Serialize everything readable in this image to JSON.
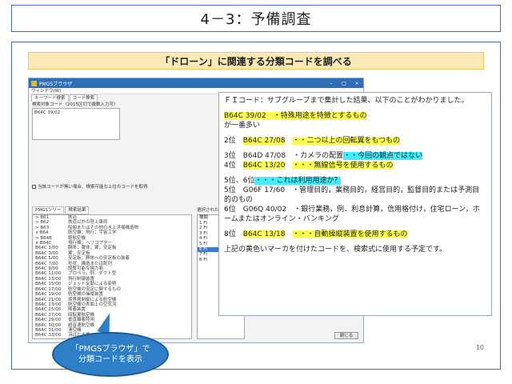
{
  "slide": {
    "title": "4－3：予備調査",
    "banner": "「ドローン」に関連する分類コードを調べる",
    "page_number": "10"
  },
  "app": {
    "title": "PMGSブラウザ",
    "menu": "ウィンドウ(W)",
    "tabs": [
      "キーワード検索",
      "コード検索"
    ],
    "input_label": "検索対象コード（2015区切で複数入力可）",
    "input_value": "B64C 39/02",
    "checkbox_label": "当該コードが無い場合、検索可能な上位のコードを取得",
    "tree_tabs": [
      "PMGSツリー",
      "検索結果"
    ],
    "tree": [
      {
        "code": "> B61",
        "desc": "鉄道"
      },
      {
        "code": "> B62",
        "desc": "鉄道以外の陸上車両"
      },
      {
        "code": "> B63",
        "desc": "船舶またはその他の水上浮揚構造物"
      },
      {
        "code": "∨ B64",
        "desc": "航空機；飛行；宇宙工学"
      },
      {
        "code": "  > B64B",
        "desc": "軽航空機"
      },
      {
        "code": "  ∨ B64C",
        "desc": "飛行機；ヘリコプター"
      },
      {
        "code": "    B64C 1/00",
        "desc": "胴体；翼体；翼；安定板"
      },
      {
        "code": "    B64C 3/00",
        "desc": "翼；安定板"
      },
      {
        "code": "    B64C 5/00",
        "desc": "安定板；胴体への安定板の装着"
      },
      {
        "code": "    B64C 7/00",
        "desc": "形状，構造または配列"
      },
      {
        "code": "    B64C 9/00",
        "desc": "調整可能な揚力面"
      },
      {
        "code": "    B64C 11/00",
        "desc": "プロペラ，例．ダクト型"
      },
      {
        "code": "    B64C 13/00",
        "desc": "飛行制御装置"
      },
      {
        "code": "    B64C 15/00",
        "desc": "ジェット反動による姿勢"
      },
      {
        "code": "    B64C 17/00",
        "desc": "航空機の安定に関するもの"
      },
      {
        "code": "    B64C 19/00",
        "desc": "航空機の操縦装置"
      },
      {
        "code": "    B64C 21/00",
        "desc": "境界層制御による航空機"
      },
      {
        "code": "    B64C 23/00",
        "desc": "航空機の表面上の空気流"
      },
      {
        "code": "    B64C 25/00",
        "desc": "降着装置"
      },
      {
        "code": "    B64C 27/00",
        "desc": "回転翼航空機"
      },
      {
        "code": "    B64C 29/00",
        "desc": "垂直離着陸用"
      },
      {
        "code": "    B64C 30/00",
        "desc": "超音速航空機"
      },
      {
        "code": "    B64C 31/00",
        "desc": "滑空機"
      },
      {
        "code": "    B64C 33/00",
        "desc": "羽ばたき機"
      },
      {
        "code": "    B64C 35/00",
        "desc": "陸上と水上の両用"
      },
      {
        "code": "    B64C 37/00",
        "desc": "複数の航空機の結合"
      },
      {
        "code": "    B64C 39/00",
        "desc": "特殊用途の航空機"
      },
      {
        "code": "  > B64D",
        "desc": "航空機の装備"
      }
    ],
    "right_list_header": "選択されたコード",
    "right_list": [
      "種類",
      "1 FI",
      "2 FI",
      "3 FI",
      "4 FI",
      "5 FI",
      "6 FI",
      "7 FI",
      "8 FI"
    ],
    "close_label": "閉じる"
  },
  "note": {
    "intro": "ＦＩコード：サブグループまで集計した結果、以下のことがわかりました。",
    "top_code": "B64C 39/02",
    "top_desc": "・特殊用途を特徴とするもの",
    "top_tail": "が一番多い",
    "r2_rank": "2位",
    "r2_code": "B64C 27/08",
    "r2_desc": "・・二つ以上の回転翼をもつもの",
    "r3_rank": "3位",
    "r3_code": "B64D 47/08",
    "r3_desc": "・カメラの配置",
    "r3_comment": "・・今回の観点ではない",
    "r4_rank": "4位",
    "r4_code": "B64C 13/20",
    "r4_desc": "・・・無線信号を使用するもの",
    "r56_rank": "5位、6位",
    "r56_comment": "・・・これは利用用途か？",
    "r5_rank": "5位",
    "r5_code": "G06F 17/60",
    "r5_desc": "・管理目的，業務目的，経営目的，監督目的または予測目的のもの",
    "r6_rank": "6位",
    "r6_code": "G06Q 40/02",
    "r6_desc": "・銀行業務，例．利息計算，信用格付け，住宅ローン，ホームまたはオンライン・バンキング",
    "r8_rank": "8位",
    "r8_code": "B64C 13/18",
    "r8_desc": "・・・自動操縦装置を使用するもの",
    "conclusion": "上記の黄色いマーカを付けたコードを、検索式に使用する予定です。"
  },
  "callout": {
    "line1": "「PMGSブラウザ」で",
    "line2": "分類コードを表示"
  }
}
